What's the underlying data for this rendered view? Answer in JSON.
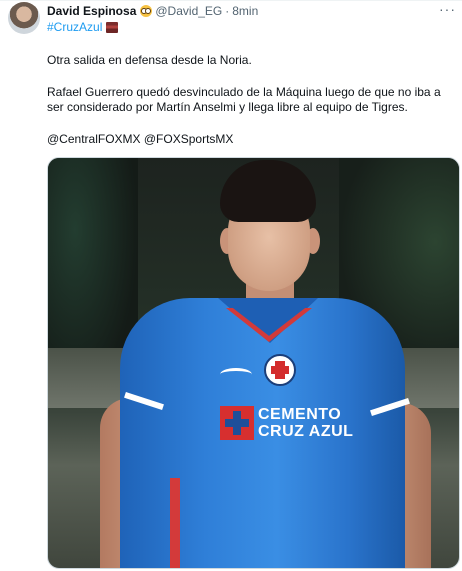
{
  "author": {
    "display_name": "David Espinosa",
    "handle": "@David_EG",
    "separator": "·",
    "time": "8min"
  },
  "hashtag": "#CruzAzul",
  "body": {
    "line1": "Otra salida en defensa desde la Noria.",
    "line2": "Rafael Guerrero quedó desvinculado de la Máquina luego de que no iba a ser considerado por Martín Anselmi y llega libre al equipo de Tigres.",
    "mentions": "@CentralFOXMX @FOXSportsMX"
  },
  "more_icon": "···",
  "media": {
    "sponsor_line1": "CEMENTO",
    "sponsor_line2": "CRUZ AZUL"
  },
  "icons": [
    "avatar",
    "nerd-face-emoji-icon",
    "more-icon",
    "train-emoji-icon"
  ],
  "colors": {
    "link": "#1d9bf0",
    "muted": "#536471",
    "text": "#0f1419"
  }
}
